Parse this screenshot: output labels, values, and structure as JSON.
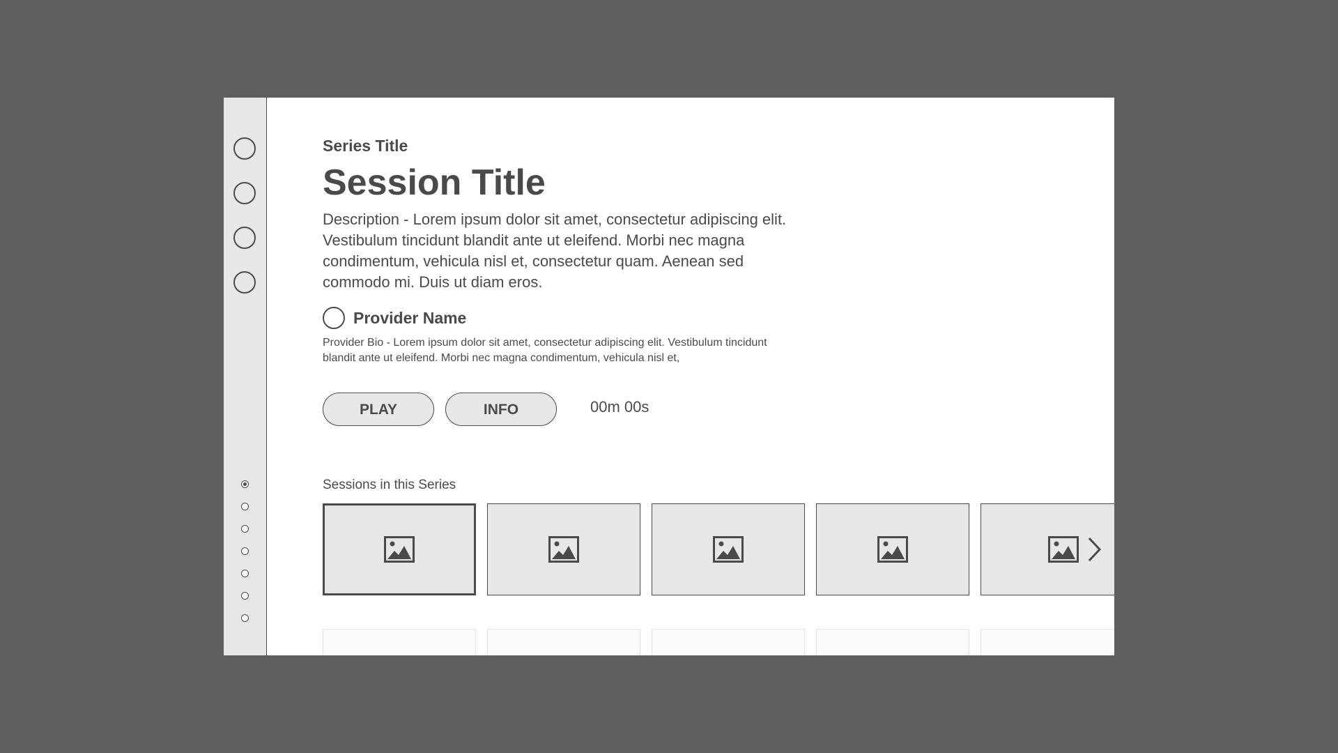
{
  "series_title": "Series Title",
  "session_title": "Session Title",
  "description": "Description - Lorem ipsum dolor sit amet, consectetur adipiscing elit. Vestibulum tincidunt blandit ante ut eleifend. Morbi nec magna condimentum, vehicula nisl et, consectetur quam. Aenean sed commodo mi. Duis ut diam eros.",
  "provider": {
    "name": "Provider Name",
    "bio": "Provider Bio - Lorem ipsum dolor sit amet, consectetur adipiscing elit. Vestibulum tincidunt blandit ante ut eleifend. Morbi nec magna condimentum, vehicula nisl et,"
  },
  "actions": {
    "play_label": "PLAY",
    "info_label": "INFO",
    "duration": "00m 00s"
  },
  "sessions": {
    "heading": "Sessions in this Series",
    "thumbnails": [
      {
        "icon": "image-placeholder-icon",
        "selected": true
      },
      {
        "icon": "image-placeholder-icon",
        "selected": false
      },
      {
        "icon": "image-placeholder-icon",
        "selected": false
      },
      {
        "icon": "image-placeholder-icon",
        "selected": false
      },
      {
        "icon": "image-placeholder-icon",
        "selected": false
      }
    ],
    "next_icon": "chevron-right-icon"
  },
  "sidebar": {
    "nav_items": [
      {
        "icon": "circle-icon"
      },
      {
        "icon": "circle-icon"
      },
      {
        "icon": "circle-icon"
      },
      {
        "icon": "circle-icon"
      }
    ],
    "page_dots_total": 7,
    "page_dot_active": 1
  },
  "colors": {
    "background": "#5e5e5e",
    "panel": "#ffffff",
    "sidebar": "#e7e7e7",
    "ink": "#4a4a4a"
  }
}
